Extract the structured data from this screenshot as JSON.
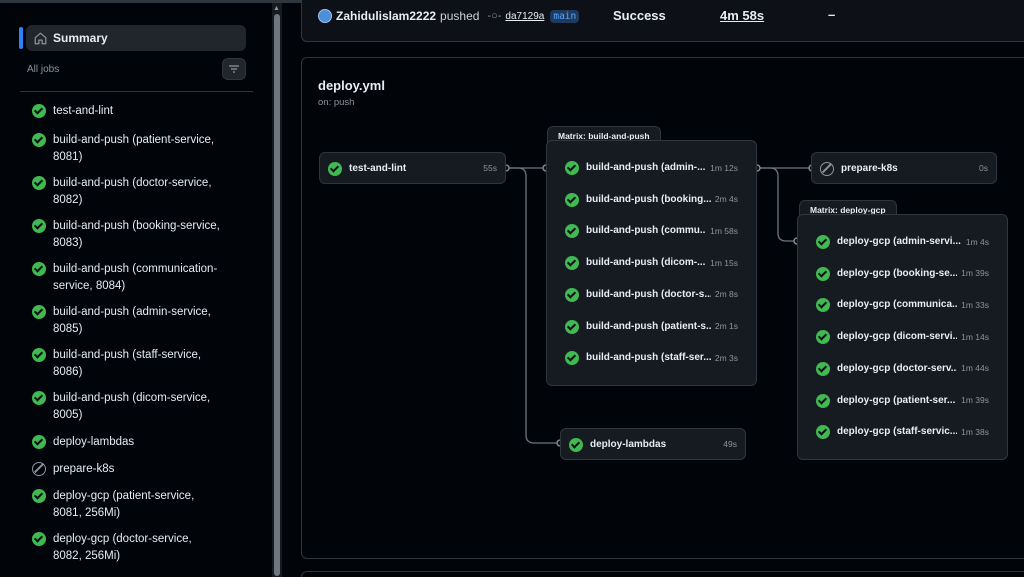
{
  "sidebar": {
    "summary_label": "Summary",
    "all_jobs_label": "All jobs",
    "jobs": [
      {
        "label": "test-and-lint",
        "status": "success"
      },
      {
        "label": "build-and-push (patient-service, 8081)",
        "status": "success"
      },
      {
        "label": "build-and-push (doctor-service, 8082)",
        "status": "success"
      },
      {
        "label": "build-and-push (booking-service, 8083)",
        "status": "success"
      },
      {
        "label": "build-and-push (communication-service, 8084)",
        "status": "success"
      },
      {
        "label": "build-and-push (admin-service, 8085)",
        "status": "success"
      },
      {
        "label": "build-and-push (staff-service, 8086)",
        "status": "success"
      },
      {
        "label": "build-and-push (dicom-service, 8005)",
        "status": "success"
      },
      {
        "label": "deploy-lambdas",
        "status": "success"
      },
      {
        "label": "prepare-k8s",
        "status": "skipped"
      },
      {
        "label": "deploy-gcp (patient-service, 8081, 256Mi)",
        "status": "success"
      },
      {
        "label": "deploy-gcp (doctor-service, 8082, 256Mi)",
        "status": "success"
      }
    ]
  },
  "run": {
    "user": "Zahidulislam2222",
    "action": "pushed",
    "sha": "da7129a",
    "branch": "main",
    "status": "Success",
    "duration": "4m 58s",
    "artifacts": "–"
  },
  "workflow": {
    "title": "deploy.yml",
    "trigger": "on: push",
    "test_job": {
      "name": "test-and-lint",
      "duration": "55s"
    },
    "build_matrix": {
      "label": "Matrix: build-and-push",
      "jobs": [
        {
          "name": "build-and-push (admin-...",
          "duration": "1m 12s"
        },
        {
          "name": "build-and-push (booking...",
          "duration": "2m 4s"
        },
        {
          "name": "build-and-push (commu...",
          "duration": "1m 58s"
        },
        {
          "name": "build-and-push (dicom-...",
          "duration": "1m 15s"
        },
        {
          "name": "build-and-push (doctor-s...",
          "duration": "2m 8s"
        },
        {
          "name": "build-and-push (patient-s...",
          "duration": "2m 1s"
        },
        {
          "name": "build-and-push (staff-ser...",
          "duration": "2m 3s"
        }
      ]
    },
    "lambdas_job": {
      "name": "deploy-lambdas",
      "duration": "49s"
    },
    "prepare_job": {
      "name": "prepare-k8s",
      "duration": "0s"
    },
    "deploy_matrix": {
      "label": "Matrix: deploy-gcp",
      "jobs": [
        {
          "name": "deploy-gcp (admin-servi...",
          "duration": "1m 4s"
        },
        {
          "name": "deploy-gcp (booking-se...",
          "duration": "1m 39s"
        },
        {
          "name": "deploy-gcp (communica...",
          "duration": "1m 33s"
        },
        {
          "name": "deploy-gcp (dicom-servi...",
          "duration": "1m 14s"
        },
        {
          "name": "deploy-gcp (doctor-serv...",
          "duration": "1m 44s"
        },
        {
          "name": "deploy-gcp (patient-ser...",
          "duration": "1m 39s"
        },
        {
          "name": "deploy-gcp (staff-servic...",
          "duration": "1m 38s"
        }
      ]
    }
  },
  "colors": {
    "success": "#3fb950",
    "accent": "#2f81f7",
    "border": "#30363d",
    "node_bg": "#161b22"
  }
}
